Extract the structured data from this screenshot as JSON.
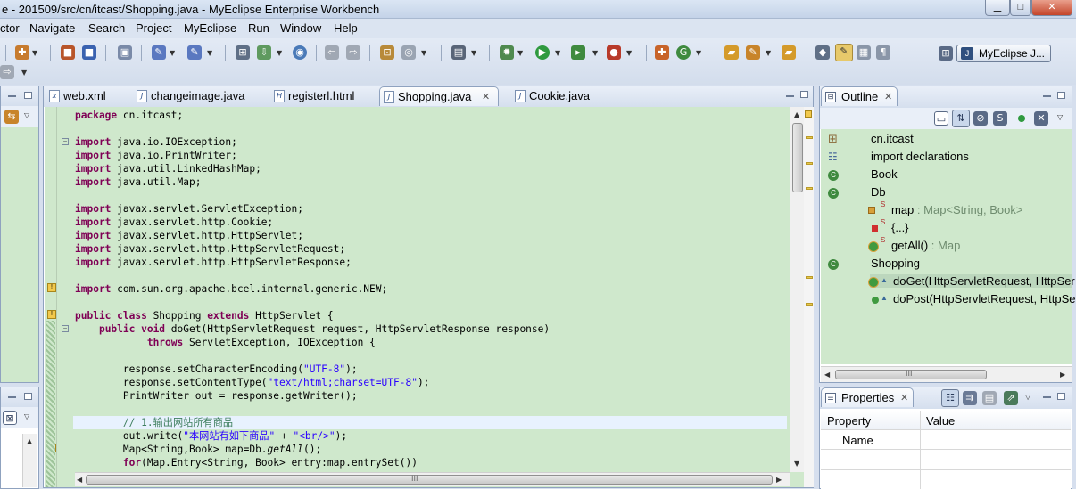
{
  "window": {
    "title": "e - 201509/src/cn/itcast/Shopping.java - MyEclipse Enterprise Workbench",
    "minimize": "▁",
    "maximize": "□",
    "close": "✕"
  },
  "menu": [
    "ctor",
    "Navigate",
    "Search",
    "Project",
    "MyEclipse",
    "Run",
    "Window",
    "Help"
  ],
  "perspective": {
    "label": "MyEclipse J..."
  },
  "editor_tabs": [
    {
      "label": "web.xml",
      "icon": "xml-file-icon"
    },
    {
      "label": "changeimage.java",
      "icon": "java-file-icon"
    },
    {
      "label": "registerl.html",
      "icon": "html-file-icon"
    },
    {
      "label": "Shopping.java",
      "icon": "java-file-icon",
      "active": true
    },
    {
      "label": "Cookie.java",
      "icon": "java-file-icon"
    }
  ],
  "code_lines": [
    [
      {
        "c": "kw",
        "t": "package"
      },
      {
        "t": " cn.itcast;"
      }
    ],
    [],
    [
      {
        "c": "kw",
        "t": "import"
      },
      {
        "t": " java.io.IOException;"
      }
    ],
    [
      {
        "c": "kw",
        "t": "import"
      },
      {
        "t": " java.io.PrintWriter;"
      }
    ],
    [
      {
        "c": "kw",
        "t": "import"
      },
      {
        "t": " java.util.LinkedHashMap;"
      }
    ],
    [
      {
        "c": "kw",
        "t": "import"
      },
      {
        "t": " java.util.Map;"
      }
    ],
    [],
    [
      {
        "c": "kw",
        "t": "import"
      },
      {
        "t": " javax.servlet.ServletException;"
      }
    ],
    [
      {
        "c": "kw",
        "t": "import"
      },
      {
        "t": " javax.servlet.http.Cookie;"
      }
    ],
    [
      {
        "c": "kw",
        "t": "import"
      },
      {
        "t": " javax.servlet.http.HttpServlet;"
      }
    ],
    [
      {
        "c": "kw",
        "t": "import"
      },
      {
        "t": " javax.servlet.http.HttpServletRequest;"
      }
    ],
    [
      {
        "c": "kw",
        "t": "import"
      },
      {
        "t": " javax.servlet.http.HttpServletResponse;"
      }
    ],
    [],
    [
      {
        "c": "kw",
        "t": "import"
      },
      {
        "t": " com.sun.org.apache.bcel.internal.generic.NEW;"
      }
    ],
    [],
    [
      {
        "c": "kw",
        "t": "public class"
      },
      {
        "t": " Shopping "
      },
      {
        "c": "kw",
        "t": "extends"
      },
      {
        "t": " HttpServlet {"
      }
    ],
    [
      {
        "t": "    "
      },
      {
        "c": "kw",
        "t": "public void"
      },
      {
        "t": " doGet(HttpServletRequest request, HttpServletResponse response)"
      }
    ],
    [
      {
        "t": "            "
      },
      {
        "c": "kw",
        "t": "throws"
      },
      {
        "t": " ServletException, IOException {"
      }
    ],
    [],
    [
      {
        "t": "        response.setCharacterEncoding("
      },
      {
        "c": "str",
        "t": "\"UTF-8\""
      },
      {
        "t": ");"
      }
    ],
    [
      {
        "t": "        response.setContentType("
      },
      {
        "c": "str",
        "t": "\"text/html;charset=UTF-8\""
      },
      {
        "t": ");"
      }
    ],
    [
      {
        "t": "        PrintWriter out = response.getWriter();"
      }
    ],
    [],
    [
      {
        "t": "        "
      },
      {
        "c": "cmt",
        "t": "// 1.输出网站所有商品"
      }
    ],
    [
      {
        "t": "        out.write("
      },
      {
        "c": "str",
        "t": "\"本网站有如下商品\""
      },
      {
        "t": " + "
      },
      {
        "c": "str",
        "t": "\"<br/>\""
      },
      {
        "t": ");"
      }
    ],
    [
      {
        "t": "        Map<String,Book> map=Db."
      },
      {
        "c": "it",
        "t": "getAll"
      },
      {
        "t": "();"
      }
    ],
    [
      {
        "t": "        "
      },
      {
        "c": "kw",
        "t": "for"
      },
      {
        "t": "(Map.Entry<String, Book> entry:map.entrySet())"
      }
    ]
  ],
  "outline": {
    "title": "Outline",
    "items": [
      {
        "label": "cn.itcast",
        "type": "",
        "icon": "package-icon"
      },
      {
        "label": "import declarations",
        "type": "",
        "icon": "imports-icon"
      },
      {
        "label": "Book",
        "type": "",
        "icon": "class-icon"
      },
      {
        "label": "Db",
        "type": "",
        "icon": "class-icon"
      },
      {
        "label": "map",
        "type": " : Map<String, Book>",
        "icon": "field-icon",
        "mod": "S"
      },
      {
        "label": "{...}",
        "type": "",
        "icon": "static-init-icon",
        "mod": "S"
      },
      {
        "label": "getAll()",
        "type": " : Map",
        "icon": "method-icon",
        "mod": "S"
      },
      {
        "label": "Shopping",
        "type": "",
        "icon": "class-icon"
      },
      {
        "label": "doGet(HttpServletRequest, HttpSer",
        "type": "",
        "icon": "public-method-icon"
      },
      {
        "label": "doPost(HttpServletRequest, HttpSe",
        "type": "",
        "icon": "public-method-icon"
      }
    ],
    "scroll_grip": "III"
  },
  "properties": {
    "title": "Properties",
    "columns": [
      "Property",
      "Value"
    ],
    "rows": [
      {
        "property": "Name",
        "value": ""
      }
    ]
  },
  "colors": {
    "editor_bg": "#cfe8cc",
    "keyword": "#7f0055",
    "string": "#2a00ff",
    "comment": "#3f7f5f"
  }
}
